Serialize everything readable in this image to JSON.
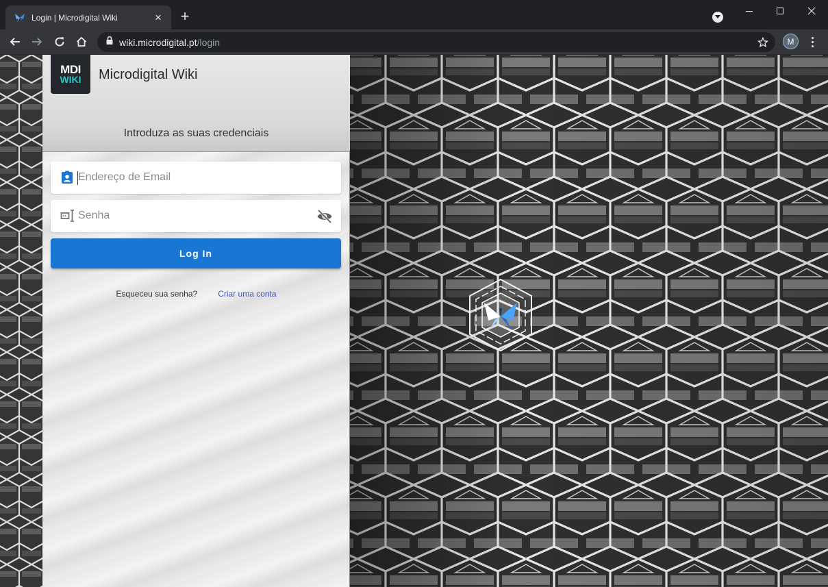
{
  "browser": {
    "tab_title": "Login | Microdigital Wiki",
    "url_host": "wiki.microdigital.pt",
    "url_path": "/login",
    "profile_initial": "M"
  },
  "page": {
    "logo_top": "MDI",
    "logo_bottom": "WIKI",
    "site_title": "Microdigital Wiki",
    "subtitle": "Introduza as suas credenciais",
    "email_placeholder": "Endereço de Email",
    "password_placeholder": "Senha",
    "login_label": "Log In",
    "forgot_label": "Esqueceu sua senha?",
    "signup_label": "Criar uma conta"
  },
  "colors": {
    "primary": "#1976d2",
    "link": "#3f51b5",
    "logo_bg": "#23262b",
    "logo_accent": "#2ec4c4"
  }
}
